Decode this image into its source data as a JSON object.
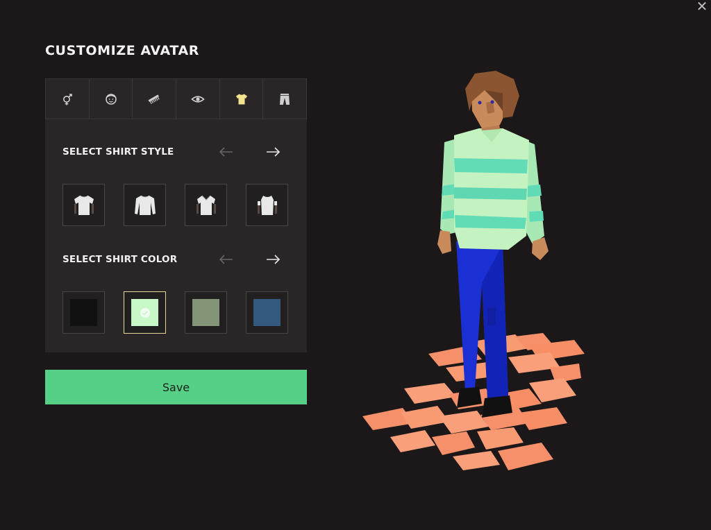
{
  "dialog": {
    "title": "CUSTOMIZE AVATAR",
    "close_label": "✕"
  },
  "tabs": [
    {
      "icon": "gender-icon",
      "active": false
    },
    {
      "icon": "face-icon",
      "active": false
    },
    {
      "icon": "comb-icon",
      "active": false
    },
    {
      "icon": "eye-icon",
      "active": false
    },
    {
      "icon": "shirt-icon",
      "active": true
    },
    {
      "icon": "pants-icon",
      "active": false
    }
  ],
  "shirt_style": {
    "title": "SELECT SHIRT STYLE",
    "styles": [
      "t-shirt",
      "long-sleeve",
      "polo",
      "sleeveless"
    ]
  },
  "shirt_color": {
    "title": "SELECT SHIRT COLOR",
    "colors": [
      "#111111",
      "#c8f7c8",
      "#839576",
      "#34597e"
    ],
    "selected_index": 1
  },
  "save_button": {
    "label": "Save"
  },
  "theme": {
    "background": "#1c1819",
    "panel": "#2a2627",
    "accent": "#56cf87",
    "active_tab_icon": "#f3e28f",
    "selected_border": "#e6d79a"
  }
}
